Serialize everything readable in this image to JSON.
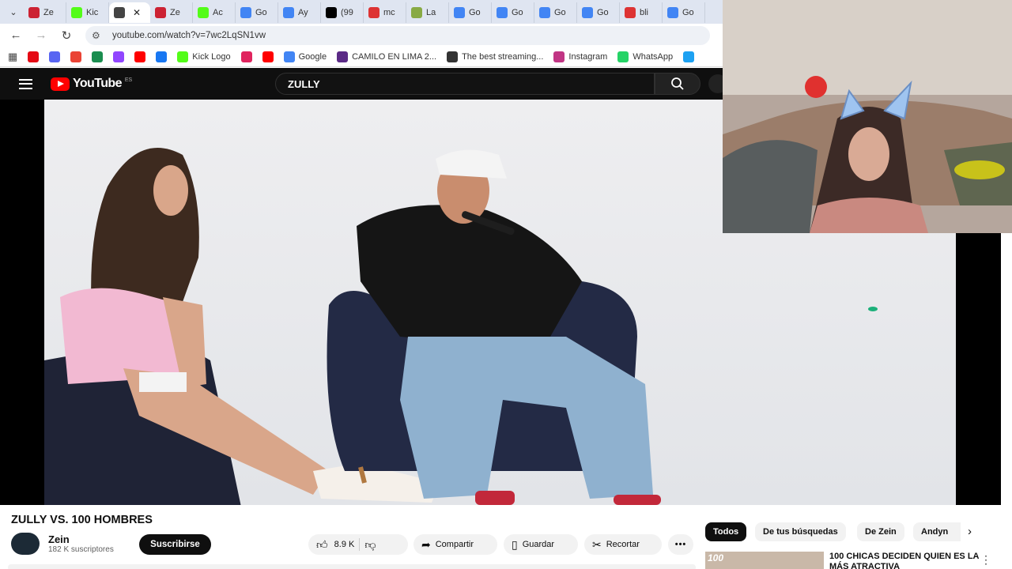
{
  "browser": {
    "tabs": [
      {
        "label": "Ze",
        "icon": "zein-favicon",
        "color": "#c23"
      },
      {
        "label": "Kic",
        "icon": "kick-favicon",
        "color": "#53fc18"
      },
      {
        "label": "",
        "icon": "audio-icon",
        "color": "#444",
        "active": true
      },
      {
        "label": "Ze",
        "icon": "zein-favicon",
        "color": "#c23"
      },
      {
        "label": "Ac",
        "icon": "kick-favicon",
        "color": "#53fc18"
      },
      {
        "label": "Go",
        "icon": "google-favicon",
        "color": "#4285f4"
      },
      {
        "label": "Ay",
        "icon": "google-favicon",
        "color": "#4285f4"
      },
      {
        "label": "(99",
        "icon": "tiktok-favicon",
        "color": "#000"
      },
      {
        "label": "mc",
        "icon": "site-favicon",
        "color": "#d33"
      },
      {
        "label": "La",
        "icon": "site-favicon",
        "color": "#8a4"
      },
      {
        "label": "Go",
        "icon": "google-favicon",
        "color": "#4285f4"
      },
      {
        "label": "Go",
        "icon": "google-favicon",
        "color": "#4285f4"
      },
      {
        "label": "Go",
        "icon": "google-favicon",
        "color": "#4285f4"
      },
      {
        "label": "Go",
        "icon": "google-favicon",
        "color": "#4285f4"
      },
      {
        "label": "bli",
        "icon": "site-favicon",
        "color": "#d33"
      },
      {
        "label": "Go",
        "icon": "google-favicon",
        "color": "#4285f4"
      }
    ],
    "url": "youtube.com/watch?v=7wc2LqSN1vw",
    "bookmarks": [
      {
        "label": "",
        "icon": "netflix-icon",
        "color": "#e50914"
      },
      {
        "label": "",
        "icon": "discord-icon",
        "color": "#5865f2"
      },
      {
        "label": "",
        "icon": "gmail-icon",
        "color": "#ea4335"
      },
      {
        "label": "",
        "icon": "app-icon",
        "color": "#1a8d4f"
      },
      {
        "label": "",
        "icon": "twitch-icon",
        "color": "#9146ff"
      },
      {
        "label": "",
        "icon": "youtube-icon",
        "color": "#ff0000"
      },
      {
        "label": "",
        "icon": "facebook-icon",
        "color": "#1877f2"
      },
      {
        "label": "Kick Logo",
        "icon": "kick-icon",
        "color": "#53fc18"
      },
      {
        "label": "",
        "icon": "app-icon",
        "color": "#e0245e"
      },
      {
        "label": "",
        "icon": "youtube-icon",
        "color": "#ff0000"
      },
      {
        "label": "Google",
        "icon": "google-icon",
        "color": "#4285f4"
      },
      {
        "label": "CAMILO EN LIMA 2...",
        "icon": "site-icon",
        "color": "#5b2a86"
      },
      {
        "label": "The best streaming...",
        "icon": "site-icon",
        "color": "#333"
      },
      {
        "label": "Instagram",
        "icon": "instagram-icon",
        "color": "#c13584"
      },
      {
        "label": "WhatsApp",
        "icon": "whatsapp-icon",
        "color": "#25d366"
      },
      {
        "label": "",
        "icon": "twitter-icon",
        "color": "#1da1f2"
      }
    ]
  },
  "youtube": {
    "logo_text": "YouTube",
    "country": "ES",
    "search_value": "ZULLY",
    "video_title": "ZULLY VS. 100 HOMBRES",
    "channel_name": "Zein",
    "subscribers": "182 K suscriptores",
    "subscribe_label": "Suscribirse",
    "likes": "8.9 K",
    "share_label": "Compartir",
    "save_label": "Guardar",
    "clip_label": "Recortar",
    "chips": [
      "Todos",
      "De tus búsquedas",
      "De Zein",
      "Andyn"
    ],
    "recommendation": {
      "title": "100 CHICAS DECIDEN QUIEN ES LA MÁS ATRACTIVA",
      "thumb_text": "100"
    }
  },
  "colors": {
    "accent": "#ff0000",
    "dark": "#0f0f0f"
  }
}
